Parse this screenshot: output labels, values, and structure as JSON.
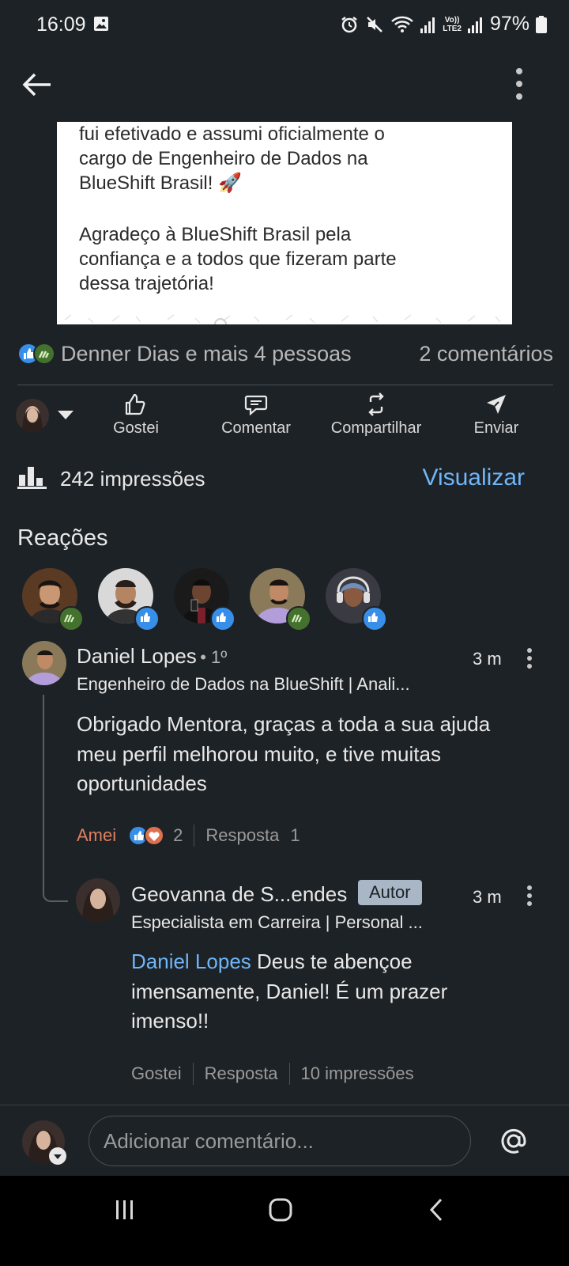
{
  "status_bar": {
    "time": "16:09",
    "battery": "97%",
    "network_label": "Vo))\nLTE2"
  },
  "post": {
    "text_lines": [
      "fui efetivado e assumi oficialmente o",
      "cargo de Engenheiro de Dados na",
      "BlueShift Brasil! 🚀",
      "Agradeço à BlueShift Brasil pela",
      "confiança e a todos que fizeram parte",
      "dessa trajetória!"
    ]
  },
  "reactions_summary": {
    "text": "Denner Dias e mais 4 pessoas",
    "comments": "2 comentários"
  },
  "actions": {
    "like": "Gostei",
    "comment": "Comentar",
    "share": "Compartilhar",
    "send": "Enviar"
  },
  "impressions": {
    "text": "242 impressões",
    "link": "Visualizar"
  },
  "reactions_section": {
    "title": "Reações"
  },
  "comments": [
    {
      "name": "Daniel Lopes",
      "degree": "• 1º",
      "subtitle": "Engenheiro de Dados na BlueShift | Anali...",
      "time": "3 m",
      "text": "Obrigado Mentora, graças a toda a sua ajuda meu perfil melhorou muito, e tive muitas oportunidades",
      "reaction_label": "Amei",
      "reaction_count": "2",
      "reply_label": "Resposta",
      "reply_count": "1"
    },
    {
      "name": "Geovanna de S...endes",
      "badge": "Autor",
      "subtitle": "Especialista em Carreira | Personal ...",
      "time": "3 m",
      "mention": "Daniel Lopes",
      "text": " Deus te abençoe imensamente, Daniel! É um prazer imenso!!",
      "like_label": "Gostei",
      "reply_label": "Resposta",
      "impressions": "10 impressões"
    }
  ],
  "comment_input": {
    "placeholder": "Adicionar comentário..."
  },
  "colors": {
    "background": "#1d2226",
    "link": "#70b5f9",
    "love": "#e07f5e"
  }
}
